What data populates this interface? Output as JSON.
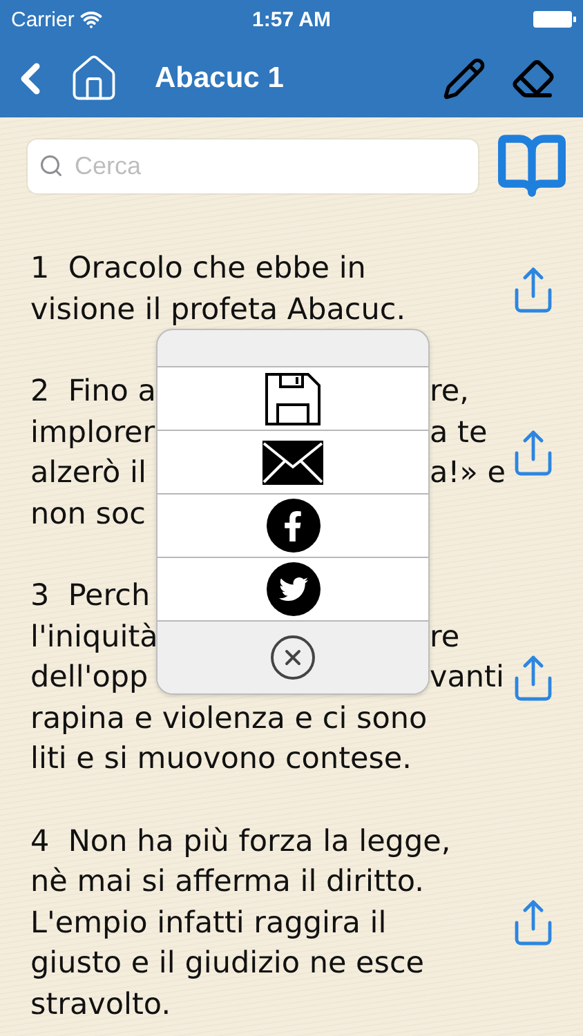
{
  "status_bar": {
    "carrier": "Carrier",
    "time": "1:57 AM"
  },
  "nav_bar": {
    "title": "Abacuc 1"
  },
  "search": {
    "placeholder": "Cerca"
  },
  "verses": [
    {
      "lines": [
        {
          "text": "1  Oracolo che ebbe in"
        },
        {
          "text": "visione il profeta Abacuc."
        }
      ]
    },
    {
      "lines": [
        {
          "left": "2  Fino a",
          "right": "re,"
        },
        {
          "left": "implorer",
          "right": "a te"
        },
        {
          "left": "alzerò il",
          "right": "a!» e"
        },
        {
          "left": "non soc"
        }
      ]
    },
    {
      "lines": [
        {
          "left": "3  Perch"
        },
        {
          "left": "l'iniquità",
          "right": "re"
        },
        {
          "left": "dell'opp",
          "right": "vanti"
        },
        {
          "text": "rapina e violenza e ci sono"
        },
        {
          "text": "liti e si muovono contese."
        }
      ]
    },
    {
      "lines": [
        {
          "text": "4  Non ha più forza la legge,"
        },
        {
          "text": "nè mai si afferma il diritto."
        },
        {
          "text": "L'empio infatti raggira il"
        },
        {
          "text": "giusto e il giudizio ne esce"
        },
        {
          "text": "stravolto."
        }
      ]
    }
  ],
  "share_menu": {
    "actions": [
      {
        "kind": "save"
      },
      {
        "kind": "email"
      },
      {
        "kind": "facebook"
      },
      {
        "kind": "twitter"
      }
    ],
    "cancel": {
      "kind": "cancel"
    }
  }
}
